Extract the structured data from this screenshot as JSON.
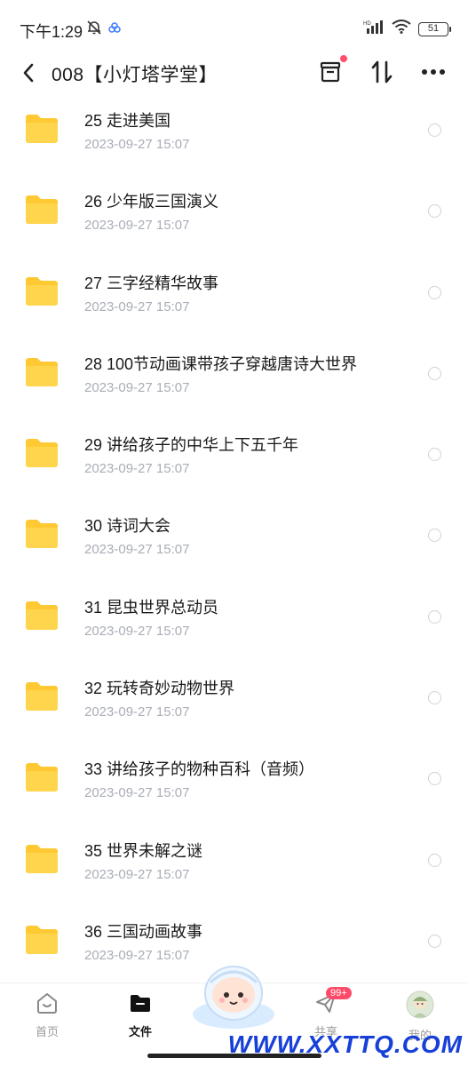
{
  "status_bar": {
    "time": "下午1:29",
    "battery": "51",
    "network_label": "HD"
  },
  "header": {
    "title": "008【小灯塔学堂】"
  },
  "files": [
    {
      "name": "25 走进美国",
      "date": "2023-09-27  15:07"
    },
    {
      "name": "26 少年版三国演义",
      "date": "2023-09-27  15:07"
    },
    {
      "name": "27 三字经精华故事",
      "date": "2023-09-27  15:07"
    },
    {
      "name": "28 100节动画课带孩子穿越唐诗大世界",
      "date": "2023-09-27  15:07"
    },
    {
      "name": "29  讲给孩子的中华上下五千年",
      "date": "2023-09-27  15:07"
    },
    {
      "name": "30 诗词大会",
      "date": "2023-09-27  15:07"
    },
    {
      "name": "31 昆虫世界总动员",
      "date": "2023-09-27  15:07"
    },
    {
      "name": "32 玩转奇妙动物世界",
      "date": "2023-09-27  15:07"
    },
    {
      "name": "33 讲给孩子的物种百科（音频）",
      "date": "2023-09-27  15:07"
    },
    {
      "name": "35 世界未解之谜",
      "date": "2023-09-27  15:07"
    },
    {
      "name": "36 三国动画故事",
      "date": "2023-09-27  15:07"
    }
  ],
  "tabbar": {
    "home": "首页",
    "files": "文件",
    "share": "共享",
    "share_badge": "99+",
    "me": "我的"
  },
  "watermark": "WWW.XXTTQ.COM",
  "colors": {
    "folder": "#ffc933",
    "date_text": "#a9adb6",
    "badge": "#ff4b6a",
    "watermark": "#1740d8"
  }
}
